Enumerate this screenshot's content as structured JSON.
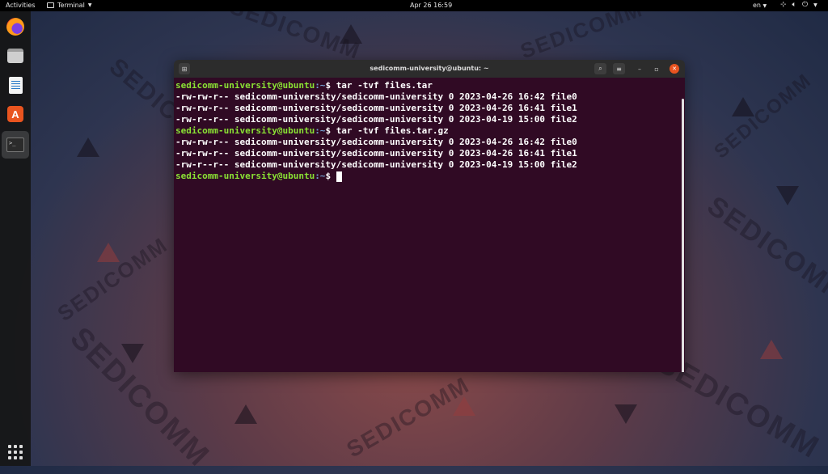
{
  "topbar": {
    "activities": "Activities",
    "app_name": "Terminal",
    "clock": "Apr 26  16:59",
    "language": "en"
  },
  "dock": {
    "items": [
      {
        "name": "firefox",
        "icon": "firefox-icon"
      },
      {
        "name": "files",
        "icon": "files-icon"
      },
      {
        "name": "libreoffice-writer",
        "icon": "writer-icon"
      },
      {
        "name": "ubuntu-software",
        "icon": "software-store-icon"
      },
      {
        "name": "terminal",
        "icon": "terminal-icon",
        "active": true
      }
    ],
    "show_apps_icon": "app-grid-icon"
  },
  "terminal": {
    "window_title": "sedicomm-university@ubuntu: ~",
    "prompt_user": "sedicomm-university@ubuntu",
    "prompt_path": ":~",
    "prompt_symbol": "$ ",
    "commands": [
      {
        "command": "tar -tvf files.tar",
        "output": [
          "-rw-rw-r-- sedicomm-university/sedicomm-university 0 2023-04-26 16:42 file0",
          "-rw-rw-r-- sedicomm-university/sedicomm-university 0 2023-04-26 16:41 file1",
          "-rw-r--r-- sedicomm-university/sedicomm-university 0 2023-04-19 15:00 file2"
        ]
      },
      {
        "command": "tar -tvf files.tar.gz",
        "output": [
          "-rw-rw-r-- sedicomm-university/sedicomm-university 0 2023-04-26 16:42 file0",
          "-rw-rw-r-- sedicomm-university/sedicomm-university 0 2023-04-26 16:41 file1",
          "-rw-r--r-- sedicomm-university/sedicomm-university 0 2023-04-19 15:00 file2"
        ]
      }
    ]
  },
  "wallpaper": {
    "watermark": "SEDICOMM"
  },
  "colors": {
    "terminal_bg": "#300a24",
    "prompt_user": "#8ae234",
    "prompt_path": "#729fcf",
    "accent": "#e95420"
  }
}
